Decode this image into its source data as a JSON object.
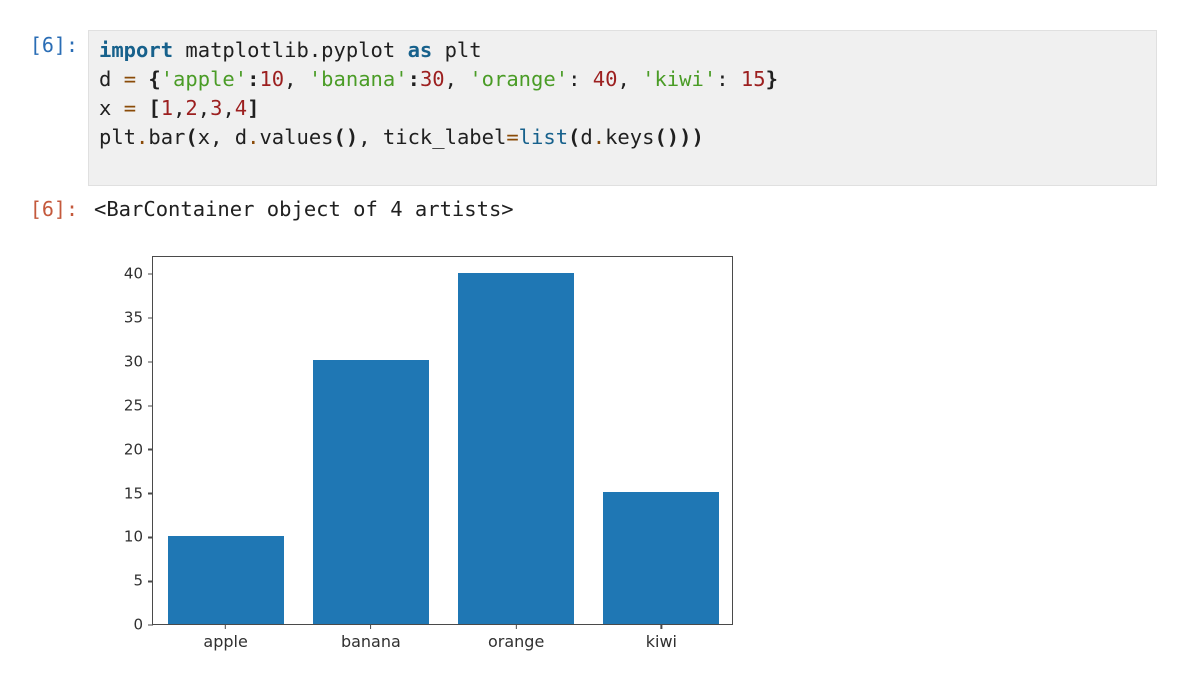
{
  "cell": {
    "input_prompt": "[6]:",
    "output_prompt": "[6]:",
    "code_lines": [
      [
        {
          "t": "import",
          "c": "kw"
        },
        {
          "t": " matplotlib.pyplot ",
          "c": "plain"
        },
        {
          "t": "as",
          "c": "kw"
        },
        {
          "t": " plt",
          "c": "plain"
        }
      ],
      [
        {
          "t": "d ",
          "c": "plain"
        },
        {
          "t": "=",
          "c": "op"
        },
        {
          "t": " ",
          "c": "plain"
        },
        {
          "t": "{",
          "c": "punct"
        },
        {
          "t": "'apple'",
          "c": "str"
        },
        {
          "t": ":",
          "c": "punct"
        },
        {
          "t": "10",
          "c": "num"
        },
        {
          "t": ", ",
          "c": "plain"
        },
        {
          "t": "'banana'",
          "c": "str"
        },
        {
          "t": ":",
          "c": "punct"
        },
        {
          "t": "30",
          "c": "num"
        },
        {
          "t": ", ",
          "c": "plain"
        },
        {
          "t": "'orange'",
          "c": "str"
        },
        {
          "t": ": ",
          "c": "plain"
        },
        {
          "t": "40",
          "c": "num"
        },
        {
          "t": ", ",
          "c": "plain"
        },
        {
          "t": "'kiwi'",
          "c": "str"
        },
        {
          "t": ": ",
          "c": "plain"
        },
        {
          "t": "15",
          "c": "num"
        },
        {
          "t": "}",
          "c": "punct"
        }
      ],
      [
        {
          "t": "x ",
          "c": "plain"
        },
        {
          "t": "=",
          "c": "op"
        },
        {
          "t": " ",
          "c": "plain"
        },
        {
          "t": "[",
          "c": "punct"
        },
        {
          "t": "1",
          "c": "num"
        },
        {
          "t": ",",
          "c": "plain"
        },
        {
          "t": "2",
          "c": "num"
        },
        {
          "t": ",",
          "c": "plain"
        },
        {
          "t": "3",
          "c": "num"
        },
        {
          "t": ",",
          "c": "plain"
        },
        {
          "t": "4",
          "c": "num"
        },
        {
          "t": "]",
          "c": "punct"
        }
      ],
      [
        {
          "t": "plt",
          "c": "plain"
        },
        {
          "t": ".",
          "c": "op"
        },
        {
          "t": "bar",
          "c": "plain"
        },
        {
          "t": "(",
          "c": "punct"
        },
        {
          "t": "x, d",
          "c": "plain"
        },
        {
          "t": ".",
          "c": "op"
        },
        {
          "t": "values",
          "c": "plain"
        },
        {
          "t": "()",
          "c": "punct"
        },
        {
          "t": ", tick_label",
          "c": "plain"
        },
        {
          "t": "=",
          "c": "op"
        },
        {
          "t": "list",
          "c": "builtin"
        },
        {
          "t": "(",
          "c": "punct"
        },
        {
          "t": "d",
          "c": "plain"
        },
        {
          "t": ".",
          "c": "op"
        },
        {
          "t": "keys",
          "c": "plain"
        },
        {
          "t": "()))",
          "c": "punct"
        }
      ]
    ],
    "output_text": "<BarContainer object of 4 artists>"
  },
  "colors": {
    "bar": "#1f77b4",
    "code_background": "#f0f0f0",
    "input_prompt": "#2a6db5",
    "output_prompt": "#c4593c",
    "axis": "#4a4a4a"
  },
  "chart_data": {
    "type": "bar",
    "title": "",
    "xlabel": "",
    "ylabel": "",
    "categories": [
      "apple",
      "banana",
      "orange",
      "kiwi"
    ],
    "values": [
      10,
      30,
      40,
      15
    ],
    "x": [
      1,
      2,
      3,
      4
    ],
    "ylim": [
      0,
      42
    ],
    "yticks": [
      0,
      5,
      10,
      15,
      20,
      25,
      30,
      35,
      40
    ],
    "ytick_labels": [
      "0",
      "5",
      "10",
      "15",
      "20",
      "25",
      "30",
      "35",
      "40"
    ],
    "grid": false,
    "legend": false,
    "bar_color": "#1f77b4",
    "bar_width_fraction": 0.8
  }
}
